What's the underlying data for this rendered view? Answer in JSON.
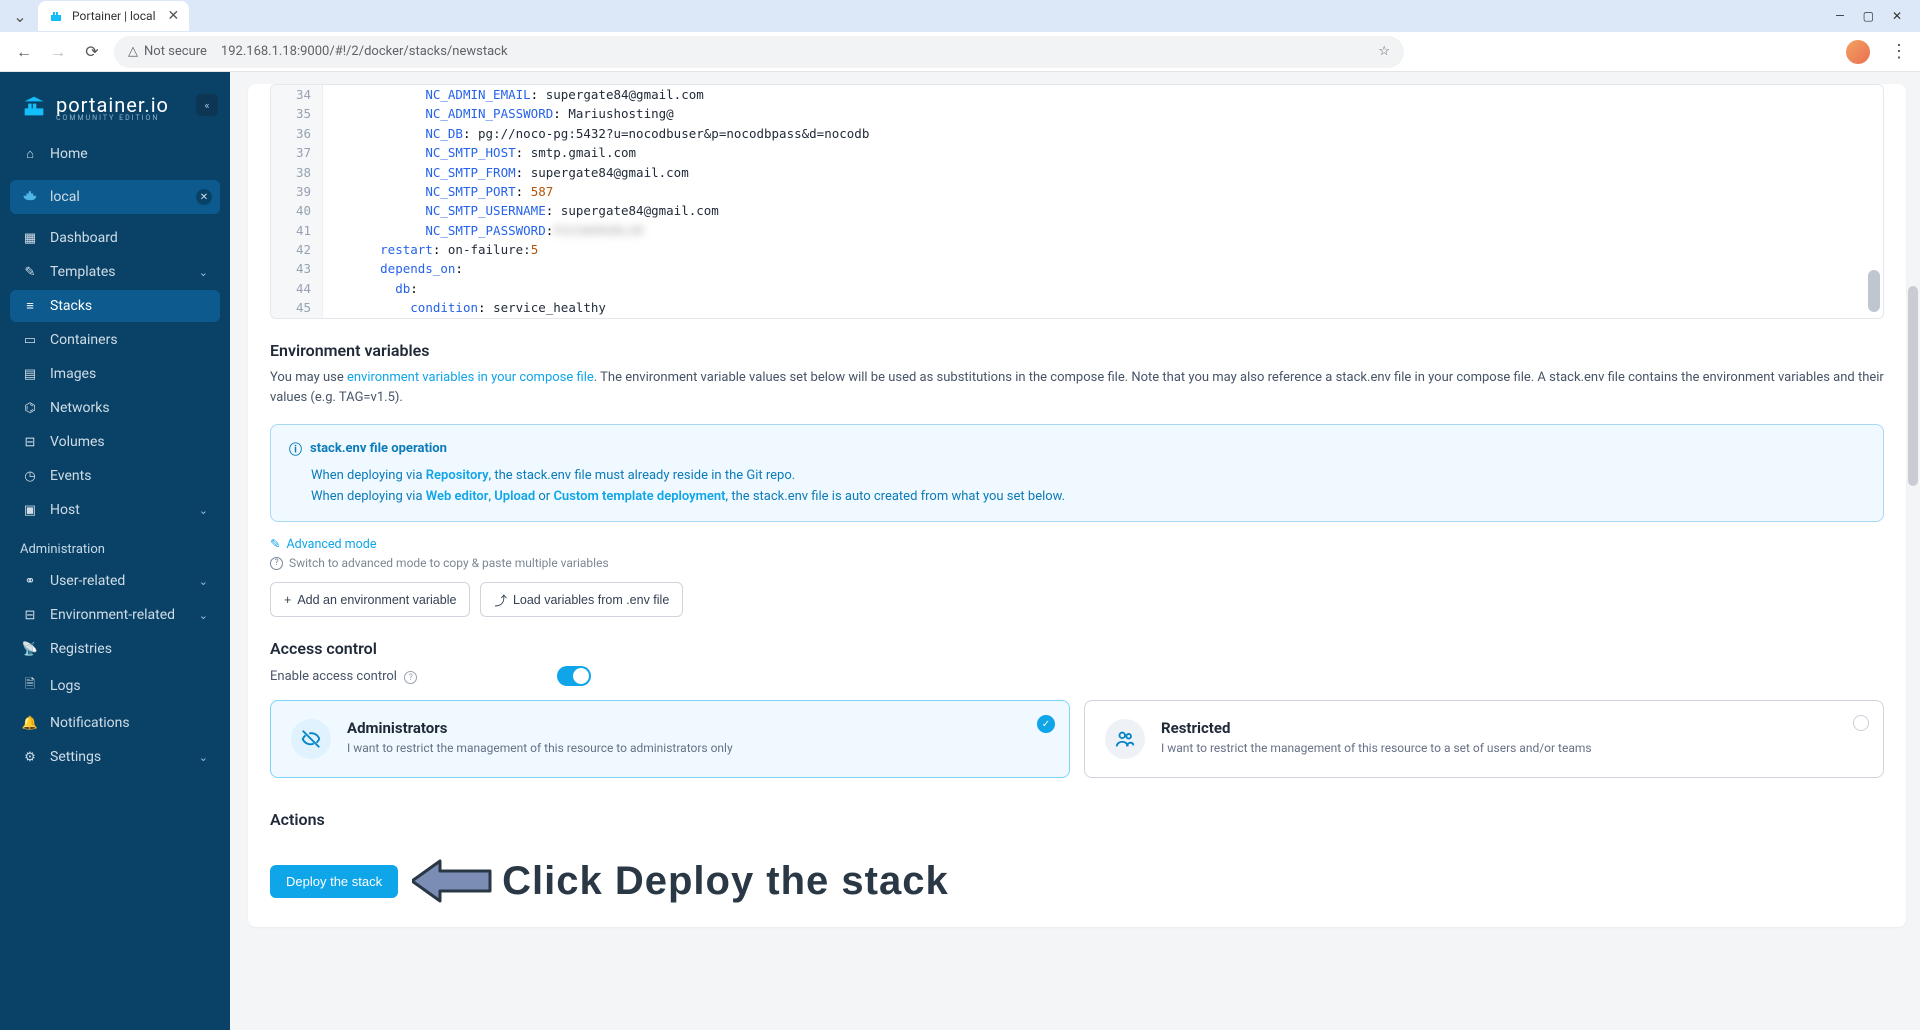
{
  "browser": {
    "tab_title": "Portainer | local",
    "not_secure_label": "Not secure",
    "url": "192.168.1.18:9000/#!/2/docker/stacks/newstack"
  },
  "sidebar": {
    "brand": "portainer.io",
    "brand_sub": "COMMUNITY EDITION",
    "home": "Home",
    "env_name": "local",
    "items": [
      {
        "label": "Dashboard"
      },
      {
        "label": "Templates"
      },
      {
        "label": "Stacks"
      },
      {
        "label": "Containers"
      },
      {
        "label": "Images"
      },
      {
        "label": "Networks"
      },
      {
        "label": "Volumes"
      },
      {
        "label": "Events"
      },
      {
        "label": "Host"
      }
    ],
    "admin_header": "Administration",
    "admin_items": [
      {
        "label": "User-related"
      },
      {
        "label": "Environment-related"
      },
      {
        "label": "Registries"
      },
      {
        "label": "Logs"
      },
      {
        "label": "Notifications"
      },
      {
        "label": "Settings"
      }
    ]
  },
  "editor": {
    "lines": [
      {
        "n": 34,
        "indent": 12,
        "key": "NC_ADMIN_EMAIL",
        "sep": ": ",
        "val": "supergate84@gmail.com"
      },
      {
        "n": 35,
        "indent": 12,
        "key": "NC_ADMIN_PASSWORD",
        "sep": ": ",
        "val": "Mariushosting@"
      },
      {
        "n": 36,
        "indent": 12,
        "key": "NC_DB",
        "sep": ": ",
        "val": "pg://noco-pg:5432?u=nocodbuser&p=nocodbpass&d=nocodb"
      },
      {
        "n": 37,
        "indent": 12,
        "key": "NC_SMTP_HOST",
        "sep": ": ",
        "val": "smtp.gmail.com"
      },
      {
        "n": 38,
        "indent": 12,
        "key": "NC_SMTP_FROM",
        "sep": ": ",
        "val": "supergate84@gmail.com"
      },
      {
        "n": 39,
        "indent": 12,
        "key": "NC_SMTP_PORT",
        "sep": ": ",
        "val": "587",
        "numeric": true
      },
      {
        "n": 40,
        "indent": 12,
        "key": "NC_SMTP_USERNAME",
        "sep": ": ",
        "val": "supergate84@gmail.com"
      },
      {
        "n": 41,
        "indent": 12,
        "key": "NC_SMTP_PASSWORD",
        "sep": ":",
        "val": "PASSWORDBLUR",
        "blur": true
      },
      {
        "n": 42,
        "indent": 6,
        "key": "restart",
        "sep": ": ",
        "val": "on-failure:",
        "suffix_num": "5"
      },
      {
        "n": 43,
        "indent": 6,
        "key": "depends_on",
        "sep": ":",
        "val": ""
      },
      {
        "n": 44,
        "indent": 8,
        "key": "db",
        "sep": ":",
        "val": ""
      },
      {
        "n": 45,
        "indent": 10,
        "key": "condition",
        "sep": ": ",
        "val": "service_healthy"
      }
    ]
  },
  "env_section": {
    "title": "Environment variables",
    "desc_pre": "You may use ",
    "desc_link": "environment variables in your compose file",
    "desc_post": ". The environment variable values set below will be used as substitutions in the compose file. Note that you may also reference a stack.env file in your compose file. A stack.env file contains the environment variables and their values (e.g. TAG=v1.5).",
    "info_title": "stack.env file operation",
    "info_line1_pre": "When deploying via ",
    "info_line1_b": "Repository",
    "info_line1_post": ", the stack.env file must already reside in the Git repo.",
    "info_line2_pre": "When deploying via ",
    "info_line2_b1": "Web editor",
    "info_line2_sep1": ", ",
    "info_line2_b2": "Upload",
    "info_line2_sep2": " or ",
    "info_line2_b3": "Custom template deployment",
    "info_line2_post": ", the stack.env file is auto created from what you set below.",
    "adv_link": "Advanced mode",
    "adv_help": "Switch to advanced mode to copy & paste multiple variables",
    "btn_add": "Add an environment variable",
    "btn_load": "Load variables from .env file"
  },
  "access": {
    "title": "Access control",
    "enable_label": "Enable access control",
    "card1_title": "Administrators",
    "card1_desc": "I want to restrict the management of this resource to administrators only",
    "card2_title": "Restricted",
    "card2_desc": "I want to restrict the management of this resource to a set of users and/or teams"
  },
  "actions": {
    "title": "Actions",
    "deploy_btn": "Deploy the stack",
    "callout": "Click Deploy the stack"
  }
}
